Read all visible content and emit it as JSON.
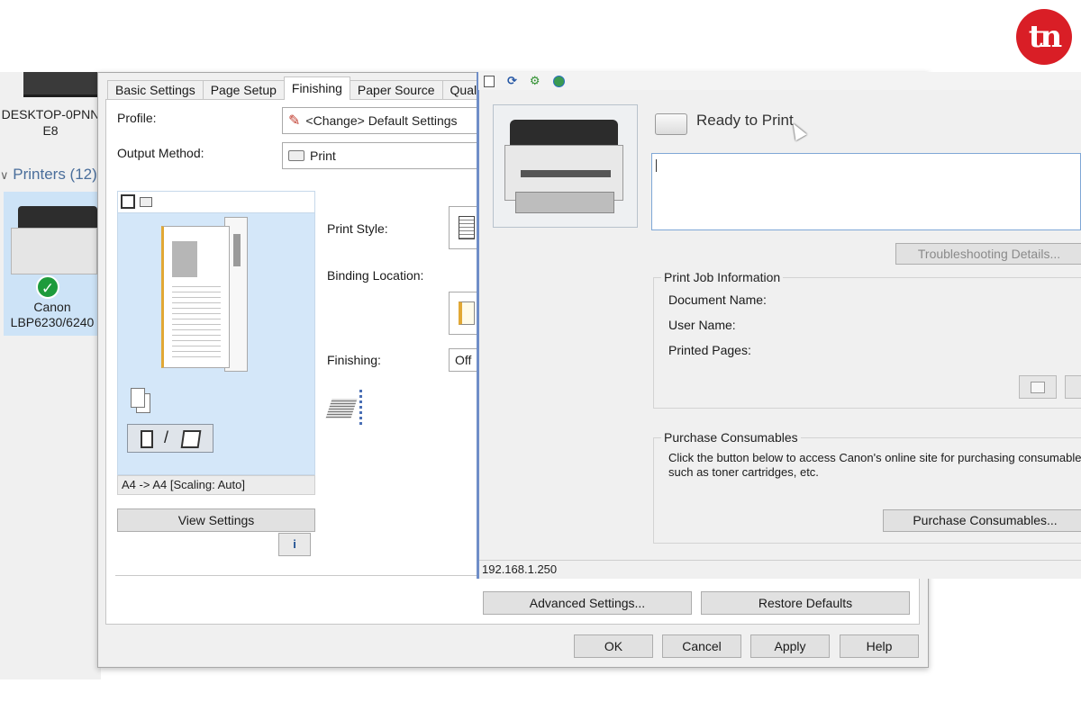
{
  "brand": {
    "logo_text": "tn",
    "color": "#d91e26"
  },
  "explorer": {
    "computer_name": "DESKTOP-0PNN",
    "computer_name_suffix": "E8",
    "printers_group": "Printers (12)",
    "printer": {
      "name_line1": "Canon",
      "name_line2": "LBP6230/6240",
      "status": "default-printer-check"
    }
  },
  "prefs": {
    "tabs": [
      {
        "label": "Basic Settings",
        "active": false
      },
      {
        "label": "Page Setup",
        "active": false
      },
      {
        "label": "Finishing",
        "active": true
      },
      {
        "label": "Paper Source",
        "active": false
      },
      {
        "label": "Quality",
        "active": false
      }
    ],
    "profile_label": "Profile:",
    "profile_value": "<Change> Default Settings",
    "output_method_label": "Output Method:",
    "output_method_value": "Print",
    "print_style_label": "Print Style:",
    "binding_location_label": "Binding Location:",
    "finishing_label": "Finishing:",
    "finishing_value": "Off",
    "preview_status": "A4 -> A4 [Scaling: Auto]",
    "view_settings_button": "View Settings",
    "advanced_settings_button": "Advanced Settings...",
    "restore_defaults_button": "Restore Defaults",
    "ok_button": "OK",
    "cancel_button": "Cancel",
    "apply_button": "Apply",
    "help_button": "Help"
  },
  "status_window": {
    "status_text": "Ready to Print",
    "troubleshooting_button": "Troubleshooting Details...",
    "print_job_info": {
      "title": "Print Job Information",
      "document_name_label": "Document Name:",
      "user_name_label": "User Name:",
      "printed_pages_label": "Printed Pages:"
    },
    "purchase": {
      "title": "Purchase Consumables",
      "description_line1": "Click the button below to access Canon's online site for purchasing consumables",
      "description_line2": "such as toner cartridges, etc.",
      "button": "Purchase Consumables..."
    },
    "ip_address": "192.168.1.250"
  }
}
